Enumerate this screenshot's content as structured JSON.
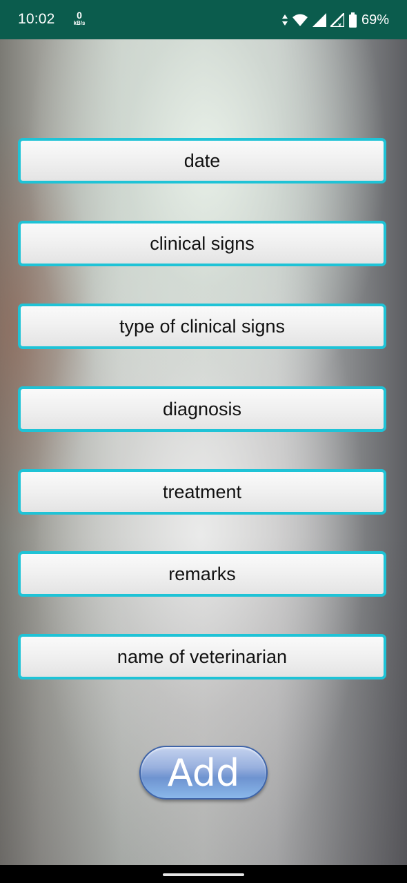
{
  "status_bar": {
    "time": "10:02",
    "net_speed_value": "0",
    "net_speed_unit": "kB/s",
    "battery_percent": "69%",
    "icons": [
      "data-arrows-icon",
      "wifi-icon",
      "signal-icon",
      "signal-no-service-icon",
      "battery-icon"
    ],
    "background_color": "#0b5c4d"
  },
  "form": {
    "fields": [
      {
        "label": "date"
      },
      {
        "label": "clinical signs"
      },
      {
        "label": "type of clinical signs"
      },
      {
        "label": "diagnosis"
      },
      {
        "label": "treatment"
      },
      {
        "label": "remarks"
      },
      {
        "label": "name of veterinarian"
      }
    ],
    "field_border_color": "#1fc3d6",
    "add_button_label": "Add"
  },
  "nav_bar": {
    "handle": "home-gesture-handle"
  }
}
